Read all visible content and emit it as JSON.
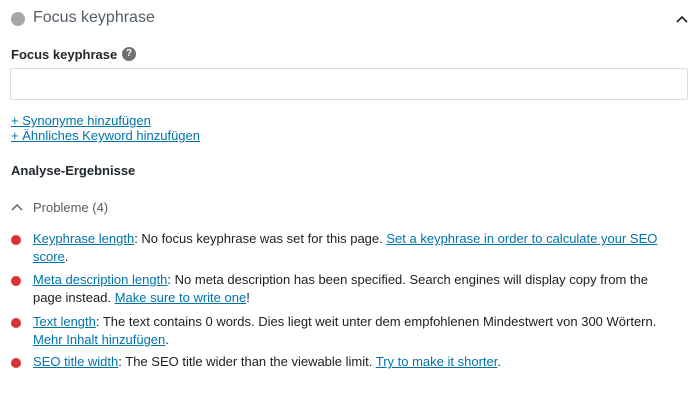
{
  "header": {
    "title": "Focus keyphrase",
    "status_color": "#a7a7a7",
    "chevron_icon": "chevron-up-icon"
  },
  "keyphrase": {
    "label": "Focus keyphrase",
    "help_icon": "?",
    "input_value": "",
    "input_placeholder": ""
  },
  "links": {
    "synonyms": "+ Synonyme hinzufügen",
    "related": "+ Ähnliches Keyword hinzufügen"
  },
  "analysis": {
    "heading": "Analyse-Ergebnisse",
    "problems_label": "Probleme (4)",
    "problem_color": "#dc3232",
    "items": [
      {
        "title": "Keyphrase length",
        "text": ": No focus keyphrase was set for this page. ",
        "action": "Set a keyphrase in order to calculate your SEO score",
        "suffix": "."
      },
      {
        "title": "Meta description length",
        "text": ": No meta description has been specified. Search engines will display copy from the page instead. ",
        "action": "Make sure to write one",
        "suffix": "!"
      },
      {
        "title": "Text length",
        "text": ": The text contains 0 words. Dies liegt weit unter dem empfohlenen Mindestwert von 300 Wörtern. ",
        "action": "Mehr Inhalt hinzufügen",
        "suffix": "."
      },
      {
        "title": "SEO title width",
        "text": ": The SEO title wider than the viewable limit. ",
        "action": "Try to make it shorter",
        "suffix": "."
      }
    ]
  }
}
